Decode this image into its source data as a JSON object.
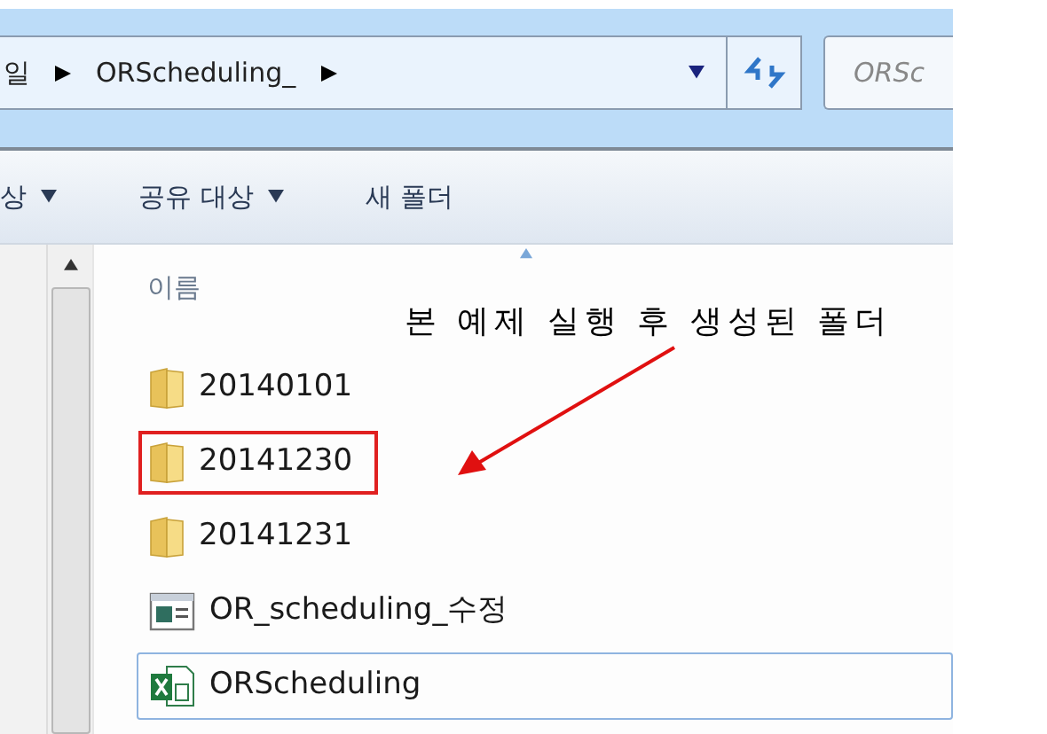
{
  "address_bar": {
    "breadcrumbs": [
      "일",
      "ORScheduling_"
    ],
    "search_placeholder": "ORSc"
  },
  "toolbar": {
    "items": [
      {
        "label": "상",
        "dropdown": true
      },
      {
        "label": "공유 대상",
        "dropdown": true
      },
      {
        "label": "새 폴더",
        "dropdown": false
      }
    ]
  },
  "file_list": {
    "column_header": "이름",
    "items": [
      {
        "kind": "folder",
        "name": "20140101",
        "highlighted": false,
        "focused": false
      },
      {
        "kind": "folder",
        "name": "20141230",
        "highlighted": true,
        "focused": false
      },
      {
        "kind": "folder",
        "name": "20141231",
        "highlighted": false,
        "focused": false
      },
      {
        "kind": "document",
        "name": "OR_scheduling_수정",
        "highlighted": false,
        "focused": false
      },
      {
        "kind": "excel",
        "name": "ORScheduling",
        "highlighted": false,
        "focused": true
      }
    ]
  },
  "annotation": {
    "text": "본 예제 실행 후 생성된 폴더"
  }
}
